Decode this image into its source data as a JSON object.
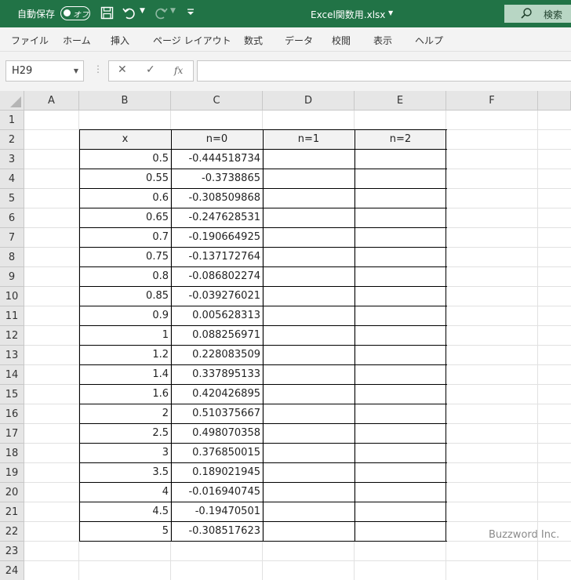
{
  "titlebar": {
    "autosave_label": "自動保存",
    "autosave_state": "オフ",
    "filename": "Excel関数用.xlsx",
    "search_label": "検索",
    "bg_color": "#217346"
  },
  "ribbon": {
    "tabs": [
      "ファイル",
      "ホーム",
      "挿入",
      "ページ レイアウト",
      "数式",
      "データ",
      "校閲",
      "表示",
      "ヘルプ"
    ]
  },
  "formula_bar": {
    "name_box": "H29",
    "fx_label": "fx",
    "formula": ""
  },
  "sheet": {
    "columns": [
      "A",
      "B",
      "C",
      "D",
      "E",
      "F"
    ],
    "rows": [
      "1",
      "2",
      "3",
      "4",
      "5",
      "6",
      "7",
      "8",
      "9",
      "10",
      "11",
      "12",
      "13",
      "14",
      "15",
      "16",
      "17",
      "18",
      "19",
      "20",
      "21",
      "22",
      "23",
      "24"
    ],
    "table_headers": [
      "x",
      "n=0",
      "n=1",
      "n=2"
    ],
    "table_rows": [
      [
        "0.5",
        "-0.444518734",
        "",
        ""
      ],
      [
        "0.55",
        "-0.3738865",
        "",
        ""
      ],
      [
        "0.6",
        "-0.308509868",
        "",
        ""
      ],
      [
        "0.65",
        "-0.247628531",
        "",
        ""
      ],
      [
        "0.7",
        "-0.190664925",
        "",
        ""
      ],
      [
        "0.75",
        "-0.137172764",
        "",
        ""
      ],
      [
        "0.8",
        "-0.086802274",
        "",
        ""
      ],
      [
        "0.85",
        "-0.039276021",
        "",
        ""
      ],
      [
        "0.9",
        "0.005628313",
        "",
        ""
      ],
      [
        "1",
        "0.088256971",
        "",
        ""
      ],
      [
        "1.2",
        "0.228083509",
        "",
        ""
      ],
      [
        "1.4",
        "0.337895133",
        "",
        ""
      ],
      [
        "1.6",
        "0.420426895",
        "",
        ""
      ],
      [
        "2",
        "0.510375667",
        "",
        ""
      ],
      [
        "2.5",
        "0.498070358",
        "",
        ""
      ],
      [
        "3",
        "0.376850015",
        "",
        ""
      ],
      [
        "3.5",
        "0.189021945",
        "",
        ""
      ],
      [
        "4",
        "-0.016940745",
        "",
        ""
      ],
      [
        "4.5",
        "-0.19470501",
        "",
        ""
      ],
      [
        "5",
        "-0.308517623",
        "",
        ""
      ]
    ]
  },
  "watermark": "Buzzword Inc."
}
